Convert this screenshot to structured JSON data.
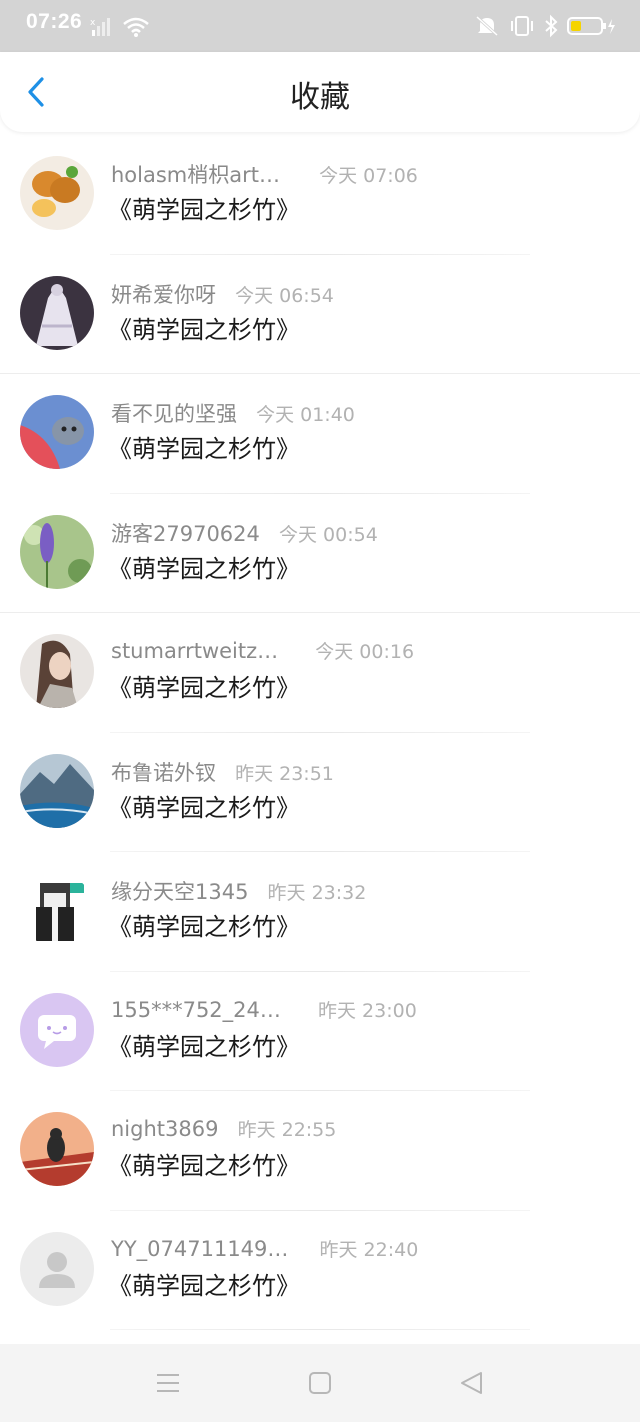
{
  "status_bar": {
    "time": "07:26",
    "battery_color": "#f5d400"
  },
  "header": {
    "title": "收藏",
    "back_icon": "chevron-left-icon",
    "accent": "#1e90e6"
  },
  "favorites": [
    {
      "user": "holasm梢枳art…",
      "time": "今天 07:06",
      "title": "《萌学园之杉竹》",
      "avatar": "food"
    },
    {
      "user": "妍希爱你呀",
      "time": "今天 06:54",
      "title": "《萌学园之杉竹》",
      "avatar": "dress"
    },
    {
      "user": "看不见的坚强",
      "time": "今天 01:40",
      "title": "《萌学园之杉竹》",
      "avatar": "cat"
    },
    {
      "user": "游客27970624",
      "time": "今天 00:54",
      "title": "《萌学园之杉竹》",
      "avatar": "flower"
    },
    {
      "user": "stumarrtweitz…",
      "time": "今天 00:16",
      "title": "《萌学园之杉竹》",
      "avatar": "girl"
    },
    {
      "user": "布鲁诺外钗",
      "time": "昨天 23:51",
      "title": "《萌学园之杉竹》",
      "avatar": "mountain"
    },
    {
      "user": "缘分天空1345",
      "time": "昨天 23:32",
      "title": "《萌学园之杉竹》",
      "avatar": "pixel"
    },
    {
      "user": "155***752_24…",
      "time": "昨天 23:00",
      "title": "《萌学园之杉竹》",
      "avatar": "chat"
    },
    {
      "user": "night3869",
      "time": "昨天 22:55",
      "title": "《萌学园之杉竹》",
      "avatar": "sunset"
    },
    {
      "user": "YY_074711149…",
      "time": "昨天 22:40",
      "title": "《萌学园之杉竹》",
      "avatar": "default"
    }
  ],
  "nav": {
    "menu_icon": "menu-icon",
    "home_icon": "square-home-icon",
    "back_icon": "triangle-back-icon"
  }
}
